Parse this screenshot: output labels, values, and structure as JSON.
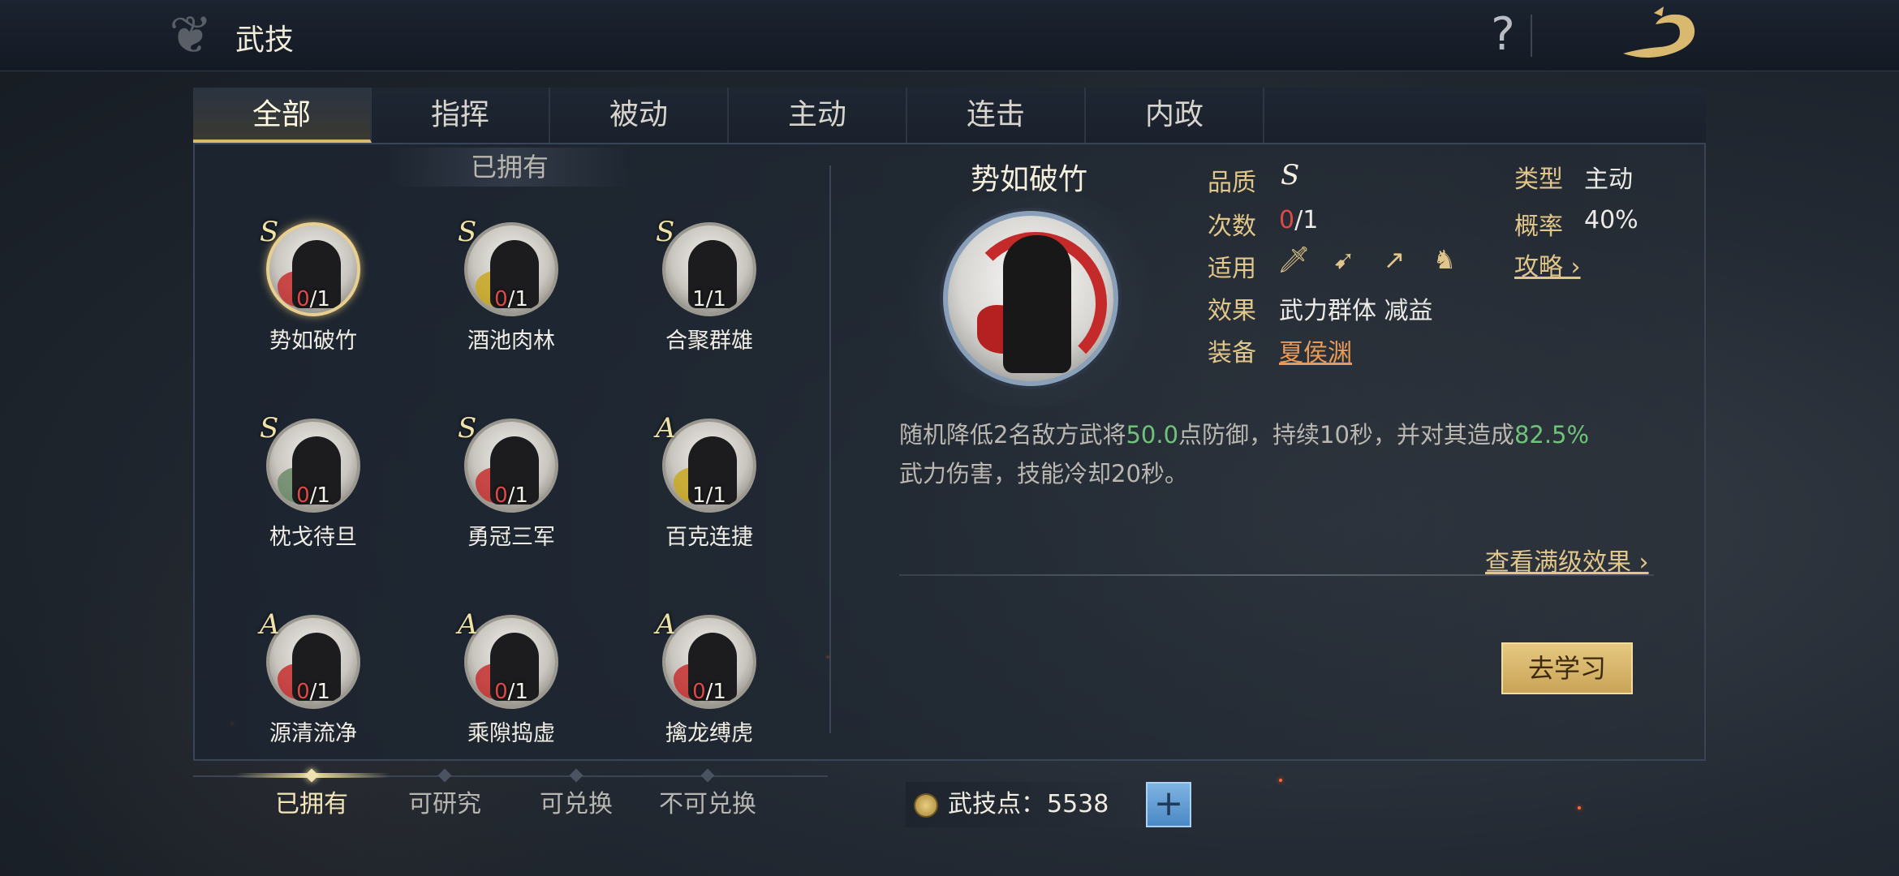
{
  "header": {
    "title": "武技",
    "help_label": "?"
  },
  "tabs": [
    {
      "label": "全部",
      "active": true
    },
    {
      "label": "指挥"
    },
    {
      "label": "被动"
    },
    {
      "label": "主动"
    },
    {
      "label": "连击"
    },
    {
      "label": "内政"
    }
  ],
  "owned_header": "已拥有",
  "skills": [
    {
      "grade": "S",
      "cur": "0",
      "max": "/1",
      "name": "势如破竹",
      "accent": "red",
      "selected": true
    },
    {
      "grade": "S",
      "cur": "0",
      "max": "/1",
      "name": "酒池肉林",
      "accent": "gold"
    },
    {
      "grade": "S",
      "cur": "1",
      "max": "/1",
      "name": "合聚群雄",
      "accent": "none"
    },
    {
      "grade": "S",
      "cur": "0",
      "max": "/1",
      "name": "枕戈待旦",
      "accent": "green"
    },
    {
      "grade": "S",
      "cur": "0",
      "max": "/1",
      "name": "勇冠三军",
      "accent": "red"
    },
    {
      "grade": "A",
      "cur": "1",
      "max": "/1",
      "name": "百克连捷",
      "accent": "gold"
    },
    {
      "grade": "A",
      "cur": "0",
      "max": "/1",
      "name": "源清流净",
      "accent": "red"
    },
    {
      "grade": "A",
      "cur": "0",
      "max": "/1",
      "name": "乘隙捣虚",
      "accent": "red"
    },
    {
      "grade": "A",
      "cur": "0",
      "max": "/1",
      "name": "擒龙缚虎",
      "accent": "red"
    }
  ],
  "detail": {
    "name": "势如破竹",
    "quality_label": "品质",
    "quality_value": "S",
    "count_label": "次数",
    "count_cur": "0",
    "count_max": "/1",
    "applies_label": "适用",
    "applies_icons": [
      "sword-icon",
      "bow-icon",
      "spear-icon",
      "horse-icon"
    ],
    "effect_label": "效果",
    "effect_value": "武力群体 减益",
    "equip_label": "装备",
    "equip_value": "夏侯渊",
    "type_label": "类型",
    "type_value": "主动",
    "rate_label": "概率",
    "rate_value": "40%",
    "guide_link": "攻略",
    "desc_1": "随机降低2名敌方武将",
    "desc_hl_1": "50.0",
    "desc_2": "点防御，持续10秒，并对其造成",
    "desc_hl_2": "82.5%",
    "desc_3": "武力伤害，技能冷却20秒。",
    "max_effect_link": "查看满级效果",
    "learn_button": "去学习"
  },
  "filters": [
    {
      "label": "已拥有",
      "active": true
    },
    {
      "label": "可研究"
    },
    {
      "label": "可兑换"
    },
    {
      "label": "不可兑换"
    }
  ],
  "points": {
    "label": "武技点：",
    "value": "5538",
    "plus": "+"
  },
  "colors": {
    "gold": "#e0c68a",
    "highlight_green": "#6fc47a",
    "zero_red": "#e04848"
  }
}
